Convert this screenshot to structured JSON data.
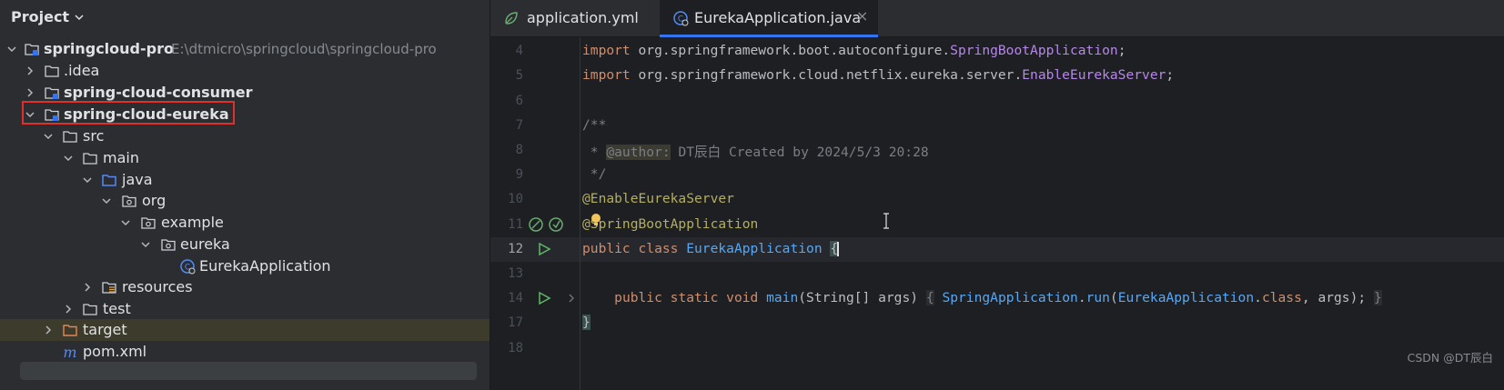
{
  "project_panel": {
    "title": "Project",
    "tree": [
      {
        "label": "springcloud-pro",
        "path": "E:\\dtmicro\\springcloud\\springcloud-pro",
        "icon": "module-folder-icon",
        "expanded": true
      },
      {
        "label": ".idea",
        "icon": "folder-icon",
        "expanded": false
      },
      {
        "label": "spring-cloud-consumer",
        "icon": "module-folder-icon",
        "expanded": false
      },
      {
        "label": "spring-cloud-eureka",
        "icon": "module-folder-icon",
        "expanded": true
      },
      {
        "label": "src",
        "icon": "folder-icon",
        "expanded": true
      },
      {
        "label": "main",
        "icon": "folder-icon",
        "expanded": true
      },
      {
        "label": "java",
        "icon": "source-folder-icon",
        "expanded": true
      },
      {
        "label": "org",
        "icon": "package-icon",
        "expanded": true
      },
      {
        "label": "example",
        "icon": "package-icon",
        "expanded": true
      },
      {
        "label": "eureka",
        "icon": "package-icon",
        "expanded": true
      },
      {
        "label": "EurekaApplication",
        "icon": "spring-boot-class-icon"
      },
      {
        "label": "resources",
        "icon": "resources-folder-icon",
        "expanded": false
      },
      {
        "label": "test",
        "icon": "folder-icon",
        "expanded": false
      },
      {
        "label": "target",
        "icon": "excluded-folder-icon",
        "expanded": false
      },
      {
        "label": "pom.xml",
        "icon": "maven-icon"
      }
    ]
  },
  "editor_tabs": [
    {
      "label": "application.yml",
      "icon": "spring-config-icon",
      "active": false
    },
    {
      "label": "EurekaApplication.java",
      "icon": "spring-boot-class-icon",
      "active": true,
      "close": "×"
    }
  ],
  "editor": {
    "line_numbers": [
      "4",
      "5",
      "6",
      "7",
      "8",
      "9",
      "10",
      "11",
      "12",
      "13",
      "14",
      "17",
      "18"
    ],
    "current_line": "12",
    "code": {
      "l4_kw": "import",
      "l4_pkg": " org.springframework.boot.autoconfigure.",
      "l4_cls": "SpringBootApplication",
      "l4_end": ";",
      "l5_kw": "import",
      "l5_pkg": " org.springframework.cloud.netflix.eureka.server.",
      "l5_cls": "EnableEurekaServer",
      "l5_end": ";",
      "l7": "/**",
      "l8_pre": " * ",
      "l8_tag": "@author:",
      "l8_rest": " DT辰白 Created by 2024/5/3 20:28",
      "l9": " */",
      "l10": "@EnableEurekaServer",
      "l11": "@SpringBootApplication",
      "l12_kw": "public class ",
      "l12_cls": "EurekaApplication",
      "l12_brace": "{",
      "l14_kw": "public static void ",
      "l14_fn": "main",
      "l14_args": "(String[] args) ",
      "l14_fold_open": "{",
      "l14_sp": " ",
      "l14_cls1": "SpringApplication",
      "l14_dot": ".",
      "l14_run": "run",
      "l14_paren": "(",
      "l14_cls2": "EurekaApplication",
      "l14_dot2": ".",
      "l14_class": "class",
      "l14_tail": ", args); ",
      "l14_fold_close": "}",
      "l17": "}"
    }
  },
  "watermark": "CSDN @DT辰白",
  "colors": {
    "accent": "#3574f0",
    "highlight_box": "#e0302e"
  }
}
